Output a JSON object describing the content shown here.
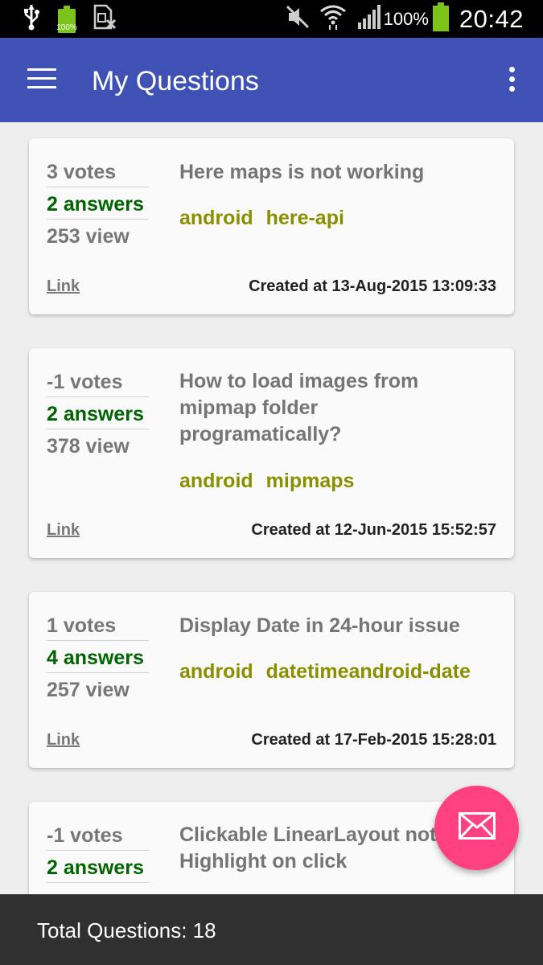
{
  "status_bar": {
    "battery_small_label": "100%",
    "signal_percent": "100%",
    "time": "20:42",
    "battery_color": "#7cc41a"
  },
  "app_bar": {
    "title": "My Questions",
    "color": "#3f51b5"
  },
  "questions": [
    {
      "votes": "3 votes",
      "answers": "2 answers",
      "views": "253 view",
      "title": "Here maps is not working",
      "tags": [
        "android",
        "here-api"
      ],
      "link": "Link",
      "created": "Created at 13-Aug-2015 13:09:33"
    },
    {
      "votes": "-1 votes",
      "answers": "2 answers",
      "views": "378 view",
      "title": "How to load images from mipmap folder programatically?",
      "tags": [
        "android",
        "mipmaps"
      ],
      "link": "Link",
      "created": "Created at 12-Jun-2015 15:52:57"
    },
    {
      "votes": "1 votes",
      "answers": "4 answers",
      "views": "257 view",
      "title": "Display Date in 24-hour issue",
      "tags": [
        "android",
        "datetimeandroid-date"
      ],
      "link": "Link",
      "created": "Created at 17-Feb-2015 15:28:01"
    },
    {
      "votes": "-1 votes",
      "answers": "2 answers",
      "views": "",
      "title": "Clickable LinearLayout not Highlight on click",
      "tags": [],
      "link": "",
      "created": ""
    }
  ],
  "fab": {
    "icon": "mail-icon",
    "color": "#ff4081"
  },
  "footer": {
    "total_label": "Total Questions: 18"
  }
}
